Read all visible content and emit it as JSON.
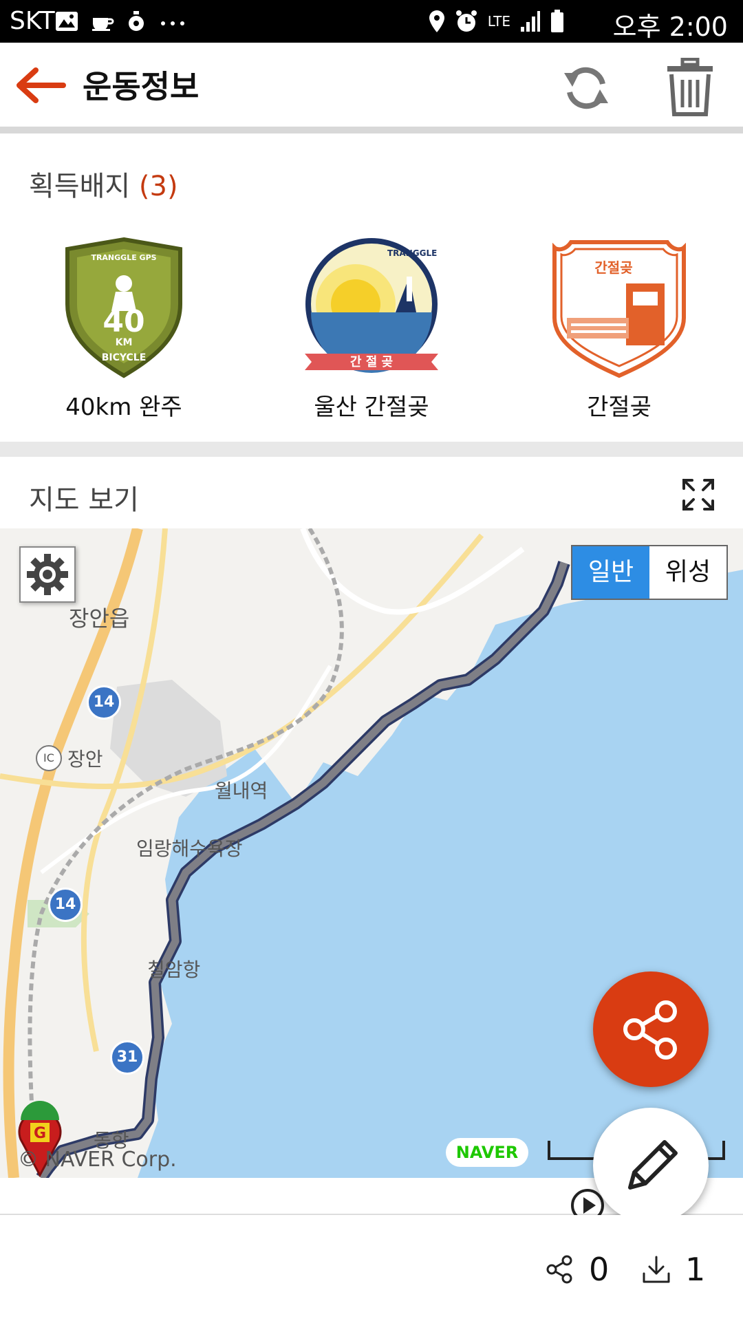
{
  "status_bar": {
    "carrier": "SKT",
    "network": "LTE",
    "time": "오후 2:00"
  },
  "header": {
    "title": "운동정보"
  },
  "badges": {
    "heading": "획득배지",
    "count_text": "(3)",
    "items": [
      {
        "label": "40km 완주",
        "icon": "bicycle-40km-badge",
        "badge_top_text": "TRANGGLE GPS",
        "badge_number": "40",
        "badge_unit": "KM",
        "badge_bottom_text": "BICYCLE"
      },
      {
        "label": "울산 간절곶",
        "icon": "lighthouse-sunrise-badge",
        "badge_top_text": "TRANGGLE",
        "badge_ribbon_text": "간 절 곶"
      },
      {
        "label": "간절곶",
        "icon": "stamp-badge",
        "badge_top_text": "간절곶"
      }
    ]
  },
  "map_section": {
    "title": "지도 보기",
    "map_types": {
      "normal": "일반",
      "satellite": "위성",
      "selected": "일반"
    },
    "place_labels": {
      "jangan_eup": "장안읍",
      "jangan_ic": "장안",
      "ic": "IC",
      "station": "월내역",
      "beach": "임랑해수욕장",
      "port_chilam": "칠암항",
      "port_dong": "동항"
    },
    "route_numbers": [
      "14",
      "14",
      "31"
    ],
    "marker_letter": "G",
    "provider_logo": "NAVER",
    "copyright": "© NAVER Corp."
  },
  "stats": {
    "shares": "0",
    "downloads": "1"
  },
  "colors": {
    "accent": "#d93c12",
    "map_selected": "#2d8de4",
    "sea": "#a8d3f2",
    "route": "#7f7f86"
  }
}
